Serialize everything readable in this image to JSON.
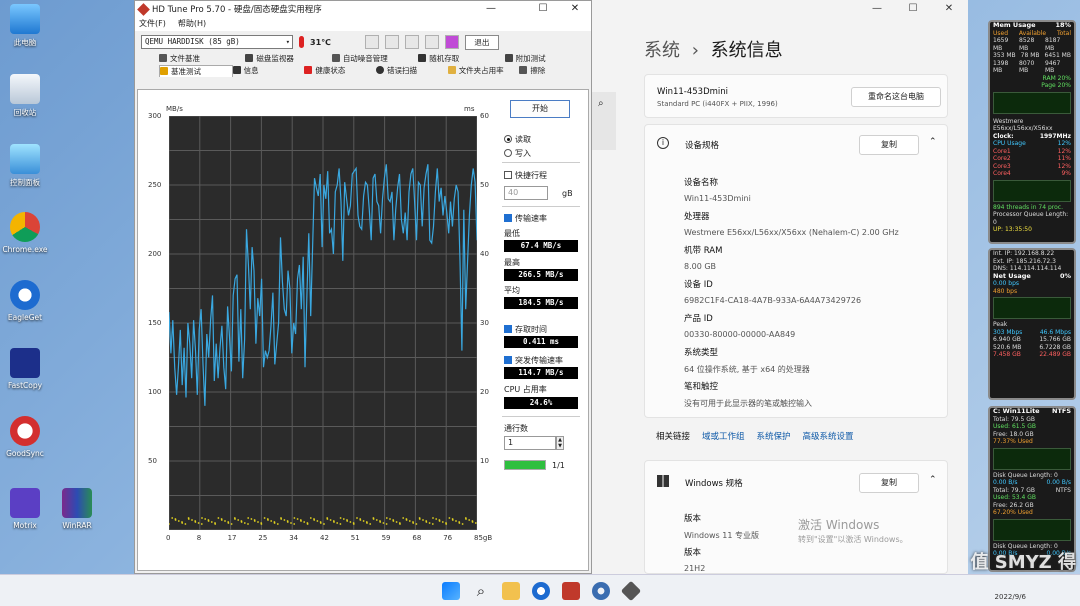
{
  "desktop": {
    "icons": [
      {
        "label": "此电脑",
        "icon": "computer-icon"
      },
      {
        "label": "回收站",
        "icon": "recycle-bin-icon"
      },
      {
        "label": "控制面板",
        "icon": "control-panel-icon"
      },
      {
        "label": "Chrome.exe",
        "icon": "chrome-icon"
      },
      {
        "label": "EagleGet",
        "icon": "eagleget-icon"
      },
      {
        "label": "FastCopy",
        "icon": "fastcopy-icon"
      },
      {
        "label": "GoodSync",
        "icon": "goodsync-icon"
      },
      {
        "label": "Motrix",
        "icon": "motrix-icon"
      },
      {
        "label": "WinRAR",
        "icon": "winrar-icon"
      }
    ]
  },
  "hdtune": {
    "title": "HD Tune Pro 5.70 - 硬盘/固态硬盘实用程序",
    "menu": [
      "文件(F)",
      "帮助(H)"
    ],
    "drive": "QEMU HARDDISK (85 gB)",
    "temperature": "31℃",
    "exit_label": "退出",
    "tabs_row1": [
      "文件基准",
      "磁盘监视器",
      "自动噪音管理",
      "随机存取",
      "附加测试"
    ],
    "tabs_row2": [
      "基准测试",
      "信息",
      "健康状态",
      "错误扫描",
      "文件夹占用率",
      "擦除"
    ],
    "start_label": "开始",
    "read_label": "读取",
    "write_label": "写入",
    "short_stroke_label": "快捷行程",
    "short_stroke_value": "40",
    "short_stroke_unit": "gB",
    "transfer_rate_label": "传输速率",
    "min_label": "最低",
    "min_value": "67.4 MB/s",
    "max_label": "最高",
    "max_value": "266.5 MB/s",
    "avg_label": "平均",
    "avg_value": "184.5 MB/s",
    "access_time_label": "存取时间",
    "access_time_value": "0.411 ms",
    "burst_label": "突发传输速率",
    "burst_value": "114.7 MB/s",
    "cpu_label": "CPU 占用率",
    "cpu_value": "24.6%",
    "passes_label": "通行数",
    "passes_value": "1",
    "progress_text": "1/1",
    "progress_fraction": 1.0
  },
  "chart_data": {
    "type": "line",
    "title": "",
    "y_left_unit": "MB/s",
    "y_right_unit": "ms",
    "ylim": [
      0,
      300
    ],
    "y_right_lim": [
      0,
      60
    ],
    "yticks_left": [
      "300",
      "250",
      "200",
      "150",
      "100",
      "50"
    ],
    "yticks_right": [
      "60",
      "50",
      "40",
      "30",
      "20",
      "10"
    ],
    "xlim": [
      0,
      85
    ],
    "xticks": [
      "0",
      "8",
      "17",
      "25",
      "34",
      "42",
      "51",
      "59",
      "68",
      "76",
      "85gB"
    ],
    "series": [
      {
        "values": [
          158,
          128,
          152,
          118,
          98,
          118,
          145,
          105,
          132,
          96,
          150,
          135,
          110,
          152,
          130,
          98,
          145,
          160,
          120,
          90,
          142,
          125,
          152,
          170,
          108,
          135,
          110,
          132,
          148,
          118,
          102,
          162,
          140,
          115,
          170,
          182,
          185,
          122,
          160,
          110,
          138,
          218,
          192,
          160,
          205,
          188,
          135,
          168,
          155,
          182,
          118,
          130,
          125,
          130,
          148,
          172,
          120,
          135,
          150,
          212,
          180,
          160,
          155,
          188,
          175,
          128,
          150,
          142,
          182,
          192,
          160,
          198,
          118,
          170,
          215,
          155,
          205,
          255,
          248,
          242,
          258,
          205,
          250,
          240,
          260,
          215,
          218,
          200,
          245,
          250,
          262,
          238,
          195,
          252,
          240,
          228,
          235,
          258,
          260,
          262,
          228,
          220,
          218,
          242,
          252,
          250,
          232,
          210,
          255,
          258,
          238,
          235,
          215,
          240,
          255,
          265,
          240,
          238,
          245,
          210,
          232,
          248,
          258,
          225,
          215,
          230,
          210,
          245,
          258,
          262,
          238,
          210,
          252,
          250,
          220,
          248,
          258,
          265,
          210,
          208,
          220,
          245,
          262,
          238,
          248,
          228,
          242,
          230,
          215,
          238,
          220,
          240,
          250,
          245,
          195,
          130,
          232,
          160,
          195,
          228,
          250,
          262,
          252,
          210
        ]
      }
    ]
  },
  "settings": {
    "breadcrumb_parent": "系统",
    "breadcrumb_sep": "›",
    "breadcrumb_current": "系统信息",
    "pc_name": "Win11-453Dmini",
    "pc_model": "Standard PC (i440FX + PIIX, 1996)",
    "rename_label": "重命名这台电脑",
    "device_spec_title": "设备规格",
    "copy_label": "复制",
    "specs": [
      {
        "k": "设备名称",
        "v": "Win11-453Dmini"
      },
      {
        "k": "处理器",
        "v": "Westmere E56xx/L56xx/X56xx (Nehalem-C)   2.00 GHz"
      },
      {
        "k": "机带 RAM",
        "v": "8.00 GB"
      },
      {
        "k": "设备 ID",
        "v": "6982C1F4-CA18-4A7B-933A-6A4A73429726"
      },
      {
        "k": "产品 ID",
        "v": "00330-80000-00000-AA849"
      },
      {
        "k": "系统类型",
        "v": "64 位操作系统, 基于 x64 的处理器"
      },
      {
        "k": "笔和触控",
        "v": "没有可用于此显示器的笔或触控输入"
      }
    ],
    "related_links_label": "相关链接",
    "links": [
      "域或工作组",
      "系统保护",
      "高级系统设置"
    ],
    "windows_spec_title": "Windows 规格",
    "edition_label": "版本",
    "edition_value": "Windows 11 专业版",
    "version_label": "版本",
    "version_value": "21H2",
    "activate_title": "激活 Windows",
    "activate_sub": "转到\"设置\"以激活 Windows。"
  },
  "gadgets": {
    "mem": {
      "title": "Mem Usage",
      "pct": "18%",
      "rows": [
        [
          "Used",
          "Available",
          "Total"
        ],
        [
          "1659 MB",
          "8528 MB",
          "8187 MB"
        ],
        [
          "353 MB",
          "78 MB",
          "6451 MB"
        ],
        [
          "1398 MB",
          "8070 MB",
          "9467 MB"
        ]
      ],
      "ram": "RAM 20%",
      "page": "Page 20%"
    },
    "cpu": {
      "name": "Westmere",
      "model": "E56xx/L56xx/X56xx",
      "clock_label": "Clock:",
      "clock": "1997MHz",
      "usage_label": "CPU Usage",
      "usage": "12%",
      "cores": [
        [
          "Core1",
          "12%"
        ],
        [
          "Core2",
          "11%"
        ],
        [
          "Core3",
          "12%"
        ],
        [
          "Core4",
          "9%"
        ]
      ],
      "threads": "894 threads in  74 proc.",
      "queue": "Processor Queue Length: 0",
      "uptime": "UP: 13:35:50"
    },
    "net": {
      "int_ip": "Int. IP: 192.168.8.22",
      "ext_ip": "Ext. IP: 185.216.72.3",
      "dns": "DNS: 114.114.114.114",
      "title": "Net Usage",
      "pct": "0%",
      "up": "0.00 bps",
      "down": "480 bps",
      "peak": "Peak",
      "peak_up": "303 Mbps",
      "peak_down": "46.6 Mbps",
      "current_up": "6.940 GB",
      "current_down": "15.766 GB",
      "total_up": "520.6 MB",
      "total_down": "6.7228 GB",
      "total2_up": "7.458 GB",
      "total2_down": "22.489 GB"
    },
    "disk": {
      "title": "C: Win11Lite",
      "fs": "NTFS",
      "total": "Total: 79.5 GB",
      "used": "Used: 61.5 GB",
      "free": "Free: 18.0 GB",
      "pct": "77.37% Used",
      "queue": "Disk Queue Length: 0",
      "rate1": "0.00 B/s",
      "rate2": "0.00 B/s",
      "title2": "Total: 79.7 GB",
      "fs2": "NTFS",
      "used2": "Used: 53.4 GB",
      "free2": "Free: 26.2 GB",
      "pct2": "67.20% Used",
      "queue2": "Disk Queue Length: 0",
      "rate3": "0.00 B/s",
      "rate4": "0.00 B/s"
    }
  },
  "taskbar": {
    "date": "2022/9/6",
    "icons": [
      "start-icon",
      "search-icon",
      "file-explorer-icon",
      "eagleget-icon",
      "app-icon",
      "settings-icon",
      "hdtune-icon"
    ]
  },
  "brand": "值 SMYZ 得"
}
